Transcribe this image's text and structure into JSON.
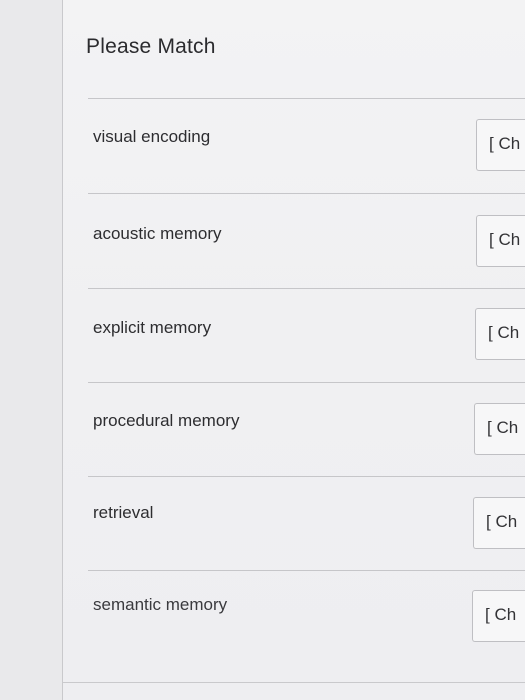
{
  "header": {
    "title": "Please Match"
  },
  "rows": [
    {
      "term": "visual encoding",
      "choice": "[ Ch"
    },
    {
      "term": "acoustic memory",
      "choice": "[ Ch"
    },
    {
      "term": "explicit memory",
      "choice": "[ Ch"
    },
    {
      "term": "procedural memory",
      "choice": "[ Ch"
    },
    {
      "term": "retrieval",
      "choice": "[ Ch"
    },
    {
      "term": "semantic memory",
      "choice": "[ Ch"
    }
  ]
}
